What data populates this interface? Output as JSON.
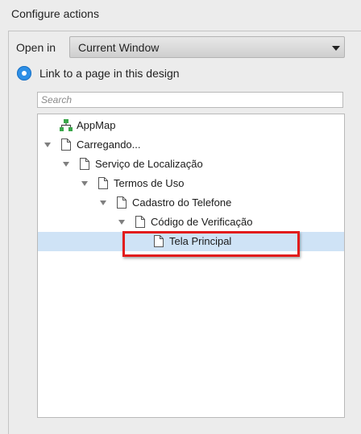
{
  "panel": {
    "title": "Configure actions"
  },
  "open_in": {
    "label": "Open in",
    "selected": "Current Window"
  },
  "link_option": {
    "label": "Link to a page in this design",
    "selected": true
  },
  "search": {
    "placeholder": "Search",
    "value": ""
  },
  "tree": [
    {
      "label": "AppMap",
      "icon": "sitemap-icon",
      "depth": 0,
      "expandable": false,
      "selected": false
    },
    {
      "label": "Carregando...",
      "icon": "page-icon",
      "depth": 0,
      "expandable": true,
      "selected": false
    },
    {
      "label": "Serviço de Localização",
      "icon": "page-icon",
      "depth": 1,
      "expandable": true,
      "selected": false
    },
    {
      "label": "Termos de Uso",
      "icon": "page-icon",
      "depth": 2,
      "expandable": true,
      "selected": false
    },
    {
      "label": "Cadastro do Telefone",
      "icon": "page-icon",
      "depth": 3,
      "expandable": true,
      "selected": false
    },
    {
      "label": "Código de Verificação",
      "icon": "page-icon",
      "depth": 4,
      "expandable": true,
      "selected": false
    },
    {
      "label": "Tela Principal",
      "icon": "page-icon",
      "depth": 5,
      "expandable": false,
      "selected": true
    }
  ],
  "colors": {
    "selection": "#cfe3f6",
    "highlight_border": "#e21c1c",
    "radio": "#2d8fe6",
    "sitemap_icon": "#3aa64a"
  }
}
